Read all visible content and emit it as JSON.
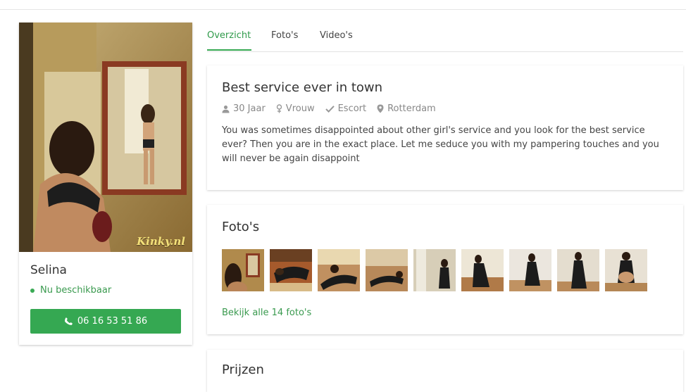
{
  "profile": {
    "name": "Selina",
    "availability": "Nu beschikbaar",
    "phone": "06 16 53 51 86",
    "photo_watermark": "Kinky.nl"
  },
  "tabs": [
    {
      "label": "Overzicht",
      "active": true
    },
    {
      "label": "Foto's",
      "active": false
    },
    {
      "label": "Video's",
      "active": false
    }
  ],
  "overview": {
    "title": "Best service ever in town",
    "meta": {
      "age": "30 Jaar",
      "gender": "Vrouw",
      "category": "Escort",
      "city": "Rotterdam"
    },
    "description": "You was sometimes disappointed about other girl's service and you look for the best service ever? Then you are in the exact place. Let me seduce you with my pampering touches and you will never be again disappoint"
  },
  "photos": {
    "title": "Foto's",
    "thumbnail_count": 9,
    "view_all": "Bekijk alle 14 foto's"
  },
  "prices": {
    "title": "Prijzen"
  },
  "colors": {
    "accent": "#35a852",
    "accent_text": "#2f9a4a",
    "muted": "#888888"
  },
  "icons": {
    "age": "user-icon",
    "gender": "female-icon",
    "category": "check-icon",
    "city": "map-marker-icon",
    "phone": "phone-icon",
    "status": "status-dot-icon"
  }
}
